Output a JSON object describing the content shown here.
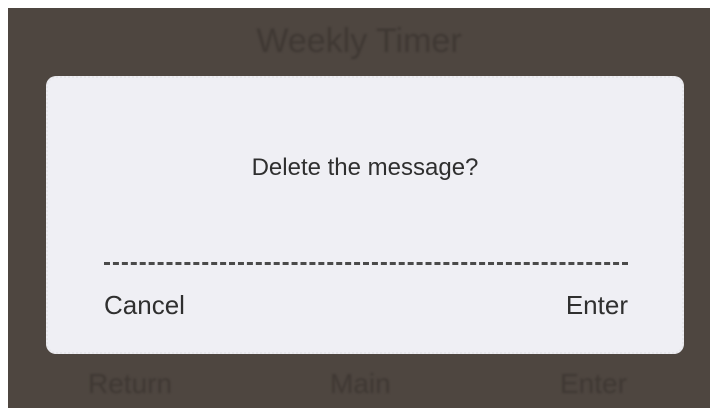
{
  "background": {
    "title": "Weekly Timer",
    "footer": {
      "return_label": "Return",
      "main_label": "Main",
      "enter_label": "Enter"
    }
  },
  "dialog": {
    "message": "Delete the message?",
    "cancel_label": "Cancel",
    "enter_label": "Enter"
  },
  "colors": {
    "backdrop": "#4e4640",
    "dialog_bg": "#efeff4",
    "text": "#2f2f2f"
  }
}
